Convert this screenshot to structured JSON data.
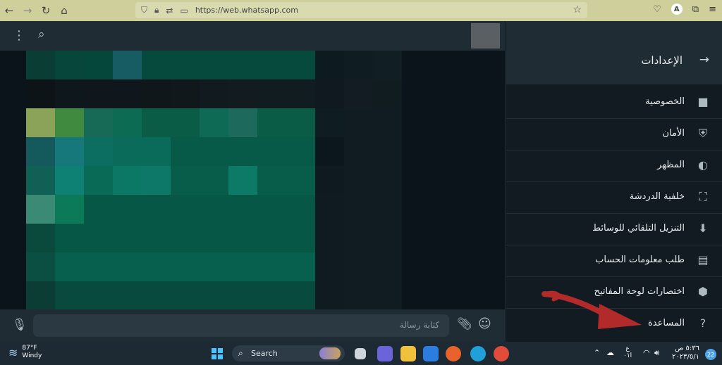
{
  "browser": {
    "url": "https://web.whatsapp.com"
  },
  "chat": {
    "composer_placeholder": "كتابة رسالة"
  },
  "settings": {
    "title": "الإعدادات",
    "items": [
      {
        "label": "الخصوصية",
        "icon": "lock-icon"
      },
      {
        "label": "الأمان",
        "icon": "shield-icon"
      },
      {
        "label": "المظهر",
        "icon": "theme-icon"
      },
      {
        "label": "خلفية الدردشة",
        "icon": "wallpaper-icon"
      },
      {
        "label": "التنزيل التلقائي للوسائط",
        "icon": "download-icon"
      },
      {
        "label": "طلب معلومات الحساب",
        "icon": "document-icon"
      },
      {
        "label": "اختصارات لوحة المفاتيح",
        "icon": "keyboard-shortcuts-icon"
      },
      {
        "label": "المساعدة",
        "icon": "help-icon"
      }
    ]
  },
  "taskbar": {
    "weather_temp": "87°F",
    "weather_desc": "Windy",
    "search_label": "Search",
    "notification_count": "22",
    "time": "٥:٣٦ ص",
    "date": "٢٠٢٣/٥/١",
    "language": "ع\nا٠١"
  },
  "colors": {
    "accent": "#00a884",
    "annotation_arrow": "#b22a2a"
  }
}
